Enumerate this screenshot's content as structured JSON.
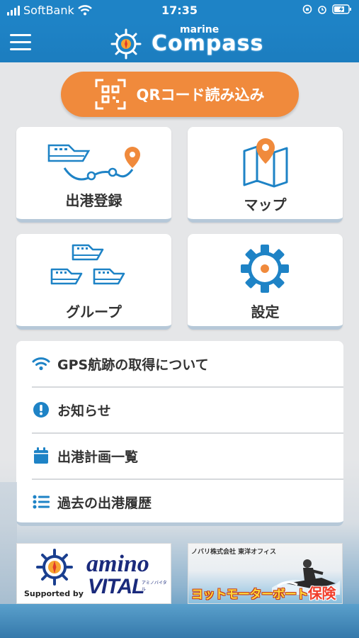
{
  "status": {
    "carrier": "SoftBank",
    "time": "17:35"
  },
  "header": {
    "logo_small": "marine",
    "logo_big": "Compass"
  },
  "qr": {
    "label": "QRコード読み込み"
  },
  "cards": [
    {
      "label": "出港登録"
    },
    {
      "label": "マップ"
    },
    {
      "label": "グループ"
    },
    {
      "label": "設定"
    }
  ],
  "list": [
    {
      "label": "GPS航跡の取得について"
    },
    {
      "label": "お知らせ"
    },
    {
      "label": "出港計画一覧"
    },
    {
      "label": "過去の出港履歴"
    }
  ],
  "banners": {
    "supported_by": "Supported by",
    "amino": "amino",
    "vital": "VITAL",
    "amino_sub": "アミノバイタル",
    "insurance_top": "ノバリ株式会社 東洋オフィス",
    "insurance_main": "ヨットモーターボート",
    "insurance_strong": "保険"
  },
  "colors": {
    "primary": "#1e83c6",
    "accent": "#f08a3c",
    "icon_blue": "#1e83c6"
  }
}
